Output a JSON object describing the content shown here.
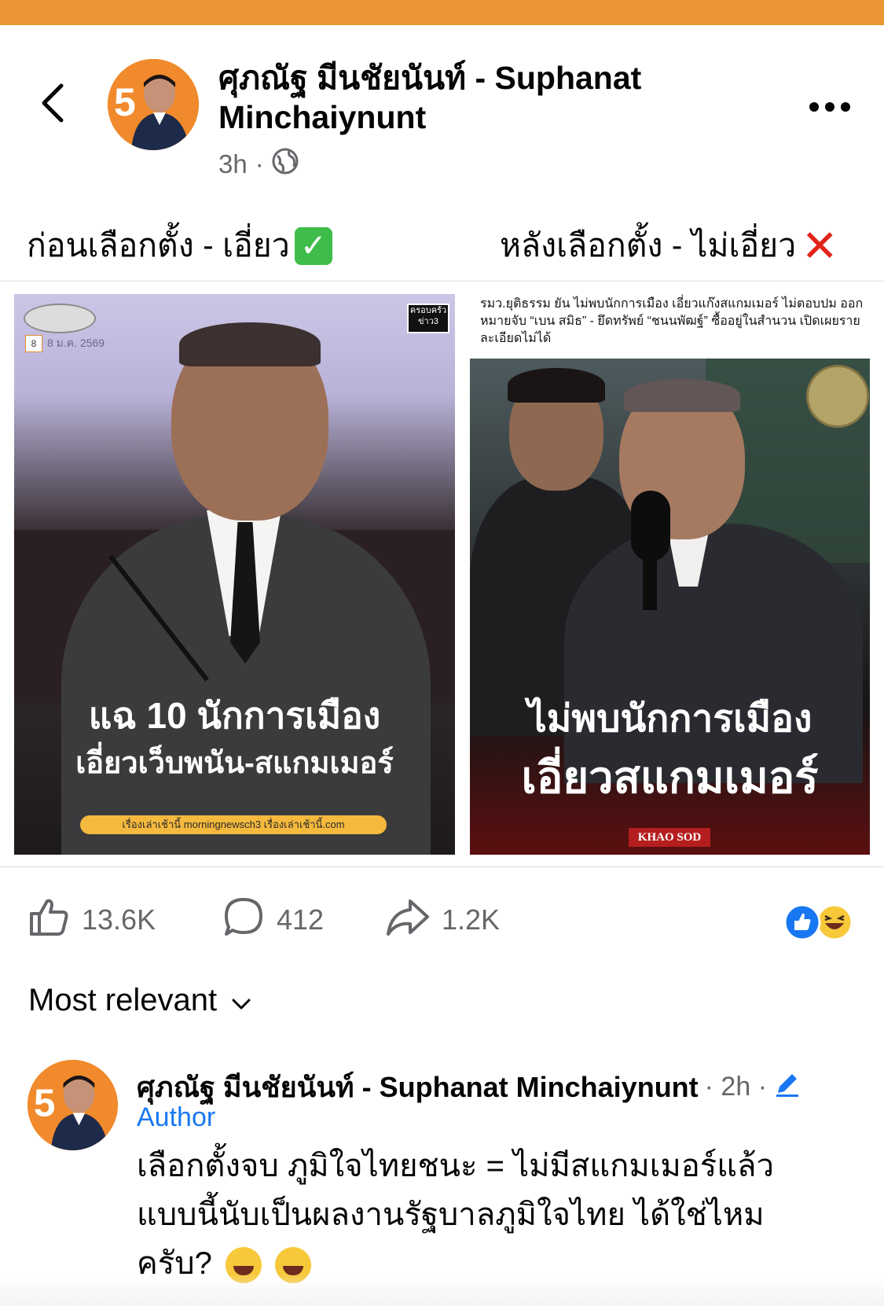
{
  "post": {
    "author": "ศุภณัฐ มีนชัยนันท์ - Suphanat Minchaiynunt",
    "time": "3h",
    "separator": "·",
    "caption_left": "ก่อนเลือกตั้ง - เอี่ยว",
    "caption_right": "หลังเลือกตั้ง - ไม่เอี่ยว"
  },
  "image_left": {
    "date": "8 ม.ค. 2569",
    "day": "8",
    "badge": "ครอบครัวข่าว3",
    "headline_1": "แฉ 10 นักการเมือง",
    "headline_2": "เอี่ยวเว็บพนัน-สแกมเมอร์",
    "footer": "เรื่องเล่าเช้านี้  morningnewsch3  เรื่องเล่าเช้านี้.com"
  },
  "image_right": {
    "quote": "รมว.ยุติธรรม ยัน ไม่พบนักการเมือง เอี่ยวแก๊งสแกมเมอร์ ไม่ตอบปม ออกหมายจับ “เบน สมิธ” - ยึดทรัพย์ “ชนนพัฒฐ์” ซื้ออยู่ในสำนวน เปิดเผยรายละเอียดไม่ได้",
    "headline_1": "ไม่พบนักการเมือง",
    "headline_2": "เอี่ยวสแกมเมอร์",
    "brand": "KHAO SOD"
  },
  "actions": {
    "likes": "13.6K",
    "comments": "412",
    "shares": "1.2K"
  },
  "sort_label": "Most relevant",
  "comment": {
    "author": "ศุภณัฐ มีนชัยนันท์ - Suphanat Minchaiynunt",
    "time": "· 2h ·",
    "badge": "Author",
    "text_line1": "เลือกตั้งจบ ภูมิใจไทยชนะ = ไม่มีสแกมเมอร์แล้ว",
    "text_line2": "แบบนี้นับเป็นผลงานรัฐบาลภูมิใจไทย ได้ใช่ไหม",
    "text_line3": "ครับ?"
  },
  "colors": {
    "brand_orange": "#e99435",
    "link_blue": "#1877f2",
    "secondary_text": "#65676b"
  },
  "icons": [
    "back-arrow-icon",
    "globe-icon",
    "more-icon",
    "check-emoji-icon",
    "cross-emoji-icon",
    "like-icon",
    "comment-icon",
    "share-icon",
    "like-reaction-icon",
    "haha-reaction-icon",
    "chevron-down-icon",
    "edit-pencil-icon",
    "laughing-emoji-icon"
  ]
}
